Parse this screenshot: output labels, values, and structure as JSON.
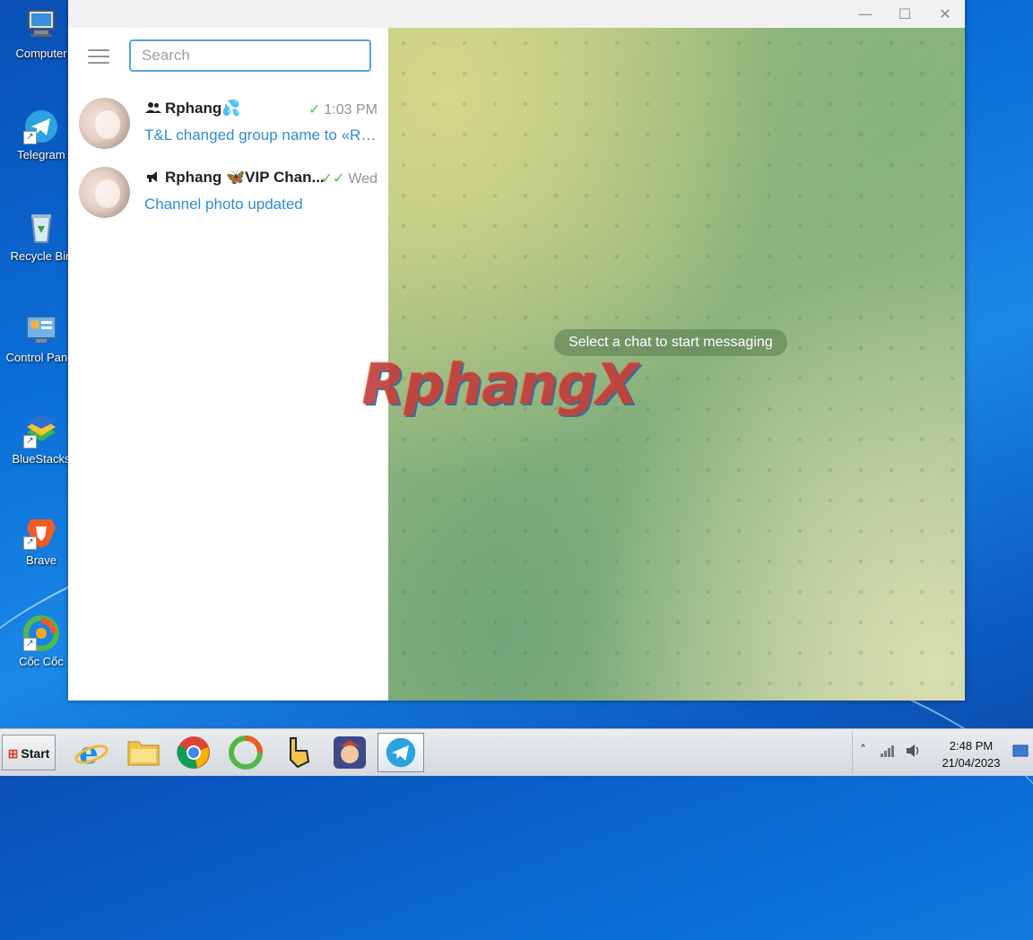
{
  "desktop": {
    "icons": [
      {
        "label": "Computer",
        "icon": "computer-icon"
      },
      {
        "label": "Telegram",
        "icon": "telegram-icon"
      },
      {
        "label": "Recycle Bin",
        "icon": "recycle-bin-icon"
      },
      {
        "label": "Control Panel",
        "icon": "control-panel-icon"
      },
      {
        "label": "BlueStacks",
        "icon": "bluestacks-icon"
      },
      {
        "label": "Brave",
        "icon": "brave-icon"
      },
      {
        "label": "Cốc Cốc",
        "icon": "coccoc-icon"
      }
    ]
  },
  "window": {
    "minimize": "—",
    "maximize": "☐",
    "close": "✕"
  },
  "sidebar": {
    "search_placeholder": "Search",
    "chats": [
      {
        "type_icon": "group-icon",
        "name": "Rphang",
        "name_emoji": "💦",
        "time": "1:03 PM",
        "status": "sent",
        "preview": "T&L changed group name to «Rp..."
      },
      {
        "type_icon": "channel-icon",
        "name": "Rphang ",
        "name_emoji": "🦋",
        "name_suffix": "VIP Chan...",
        "time": "Wed",
        "status": "read",
        "preview": "Channel photo updated"
      }
    ]
  },
  "chat_area": {
    "empty_message": "Select a chat to start messaging",
    "watermark": "RphangX"
  },
  "taskbar": {
    "start_label": "Start",
    "apps": [
      "internet-explorer-icon",
      "file-explorer-icon",
      "chrome-icon",
      "coccoc-icon",
      "pointer-app-icon",
      "game-app-icon",
      "telegram-icon"
    ],
    "time": "2:48 PM",
    "date": "21/04/2023"
  },
  "colors": {
    "accent": "#52a7e0",
    "link": "#2f8cd8",
    "check": "#4fbf5a"
  }
}
